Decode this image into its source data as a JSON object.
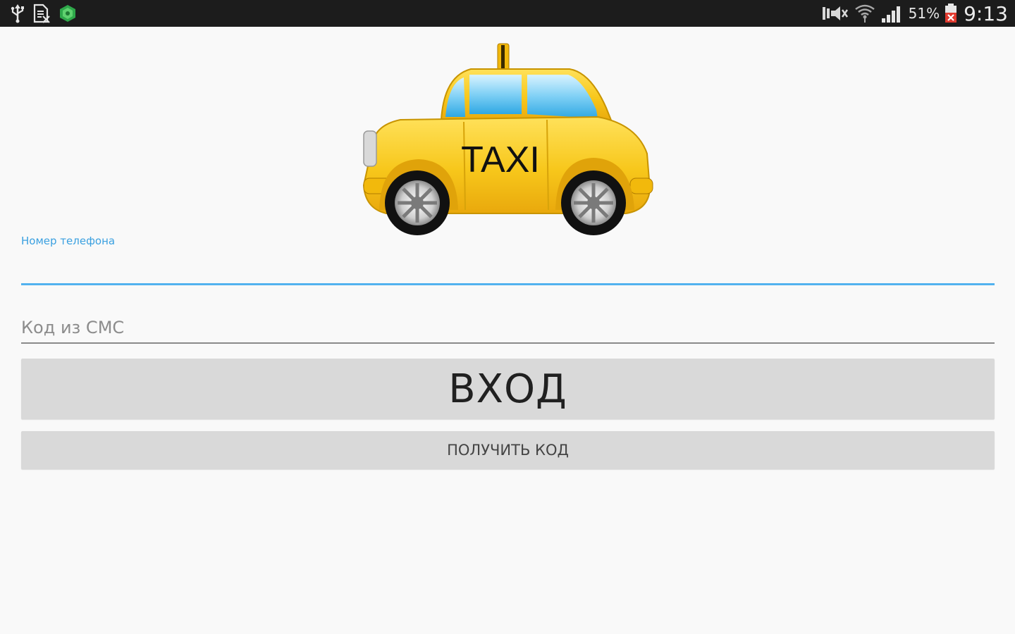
{
  "status_bar": {
    "battery_percent": "51%",
    "time": "9:13",
    "icons_left": [
      "usb-icon",
      "document-icon",
      "shield-app-icon"
    ],
    "icons_right": [
      "mute-icon",
      "wifi-icon",
      "signal-icon",
      "battery-icon"
    ]
  },
  "logo": {
    "text": "TAXI"
  },
  "form": {
    "phone_label": "Номер телефона",
    "phone_value": "",
    "sms_placeholder": "Код из СМС",
    "sms_value": ""
  },
  "buttons": {
    "login_label": "ВХОД",
    "get_code_label": "ПОЛУЧИТЬ КОД"
  },
  "colors": {
    "accent": "#52b2ef",
    "status_bar": "#1c1c1c",
    "button_bg": "#d9d9d9",
    "taxi_yellow": "#f7c71b"
  }
}
